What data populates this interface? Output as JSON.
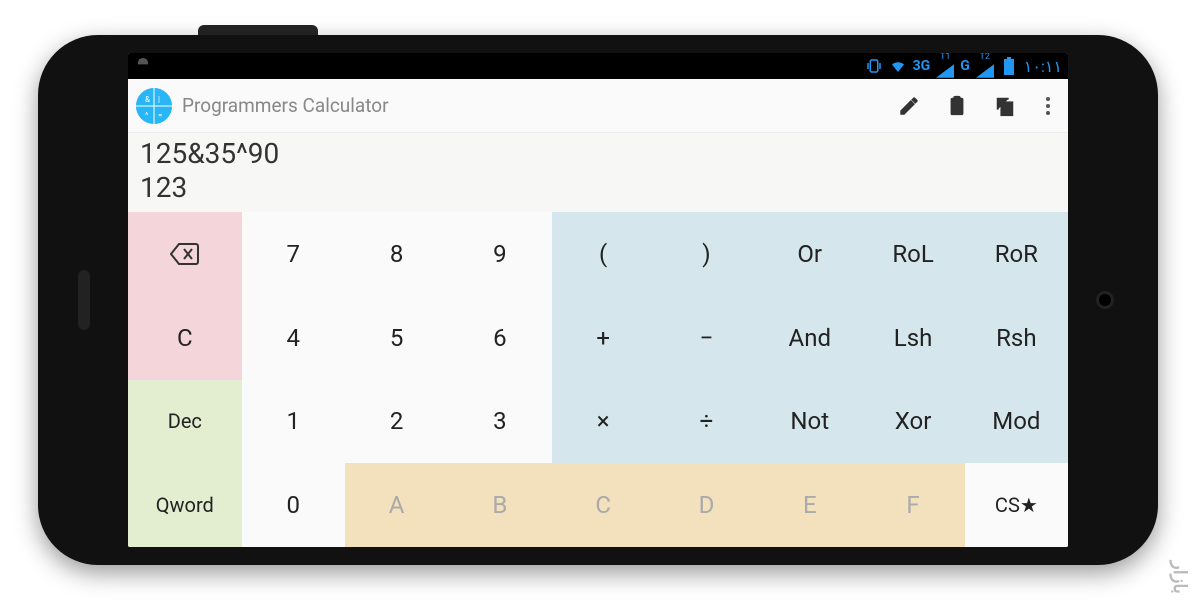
{
  "statusbar": {
    "network_label_1": "3G",
    "network_label_2": "G",
    "sim1": "T1",
    "sim2": "T2",
    "time": "١٠:١١"
  },
  "header": {
    "title": "Programmers Calculator"
  },
  "display": {
    "expression": "125&35^90",
    "result": "123"
  },
  "keys": {
    "backspace": "⌫",
    "clear": "C",
    "dec": "Dec",
    "qword": "Qword",
    "d7": "7",
    "d8": "8",
    "d9": "9",
    "d4": "4",
    "d5": "5",
    "d6": "6",
    "d1": "1",
    "d2": "2",
    "d3": "3",
    "d0": "0",
    "hexA": "A",
    "hexB": "B",
    "hexC": "C",
    "hexD": "D",
    "hexE": "E",
    "hexF": "F",
    "lparen": "(",
    "rparen": ")",
    "plus": "+",
    "minus": "−",
    "times": "×",
    "divide": "÷",
    "or": "Or",
    "rol": "RoL",
    "ror": "RoR",
    "and": "And",
    "lsh": "Lsh",
    "rsh": "Rsh",
    "not": "Not",
    "xor": "Xor",
    "mod": "Mod",
    "cs": "CS★"
  },
  "watermark": "ﺑﺎزار"
}
